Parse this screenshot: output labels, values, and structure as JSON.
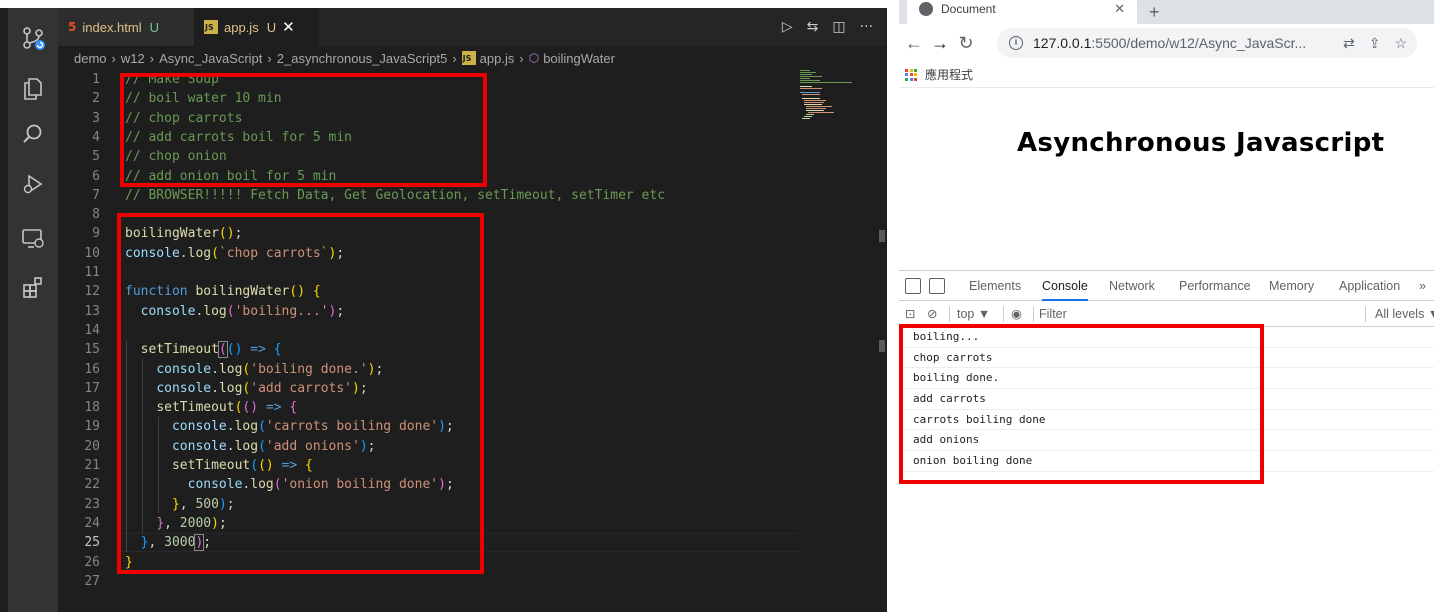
{
  "vscode": {
    "tabs": [
      {
        "label": "index.html",
        "status": "U",
        "icon": "html-file-icon"
      },
      {
        "label": "app.js",
        "status": "U",
        "icon": "js-file-icon",
        "active": true
      }
    ],
    "js_icon_text": "JS",
    "breadcrumb": [
      "demo",
      "w12",
      "Async_JavaScript",
      "2_asynchronous_JavaScript5",
      "app.js",
      "boilingWater"
    ],
    "current_line": 25
  },
  "browser": {
    "tab_title": "Document",
    "address": {
      "host": "127.0.0.1",
      "rest": ":5500/demo/w12/Async_JavaScr..."
    },
    "bookmarks_label": "應用程式",
    "page_heading": "Asynchronous Javascript",
    "devtools": {
      "tabs": [
        "Elements",
        "Console",
        "Network",
        "Performance",
        "Memory",
        "Application"
      ],
      "active_tab": "Console",
      "more": "»",
      "context": "top ▼",
      "filter_placeholder": "Filter",
      "levels": "All levels ▼"
    },
    "console_output": [
      "boiling...",
      "chop carrots",
      "boiling done.",
      "add carrots",
      "carrots boiling done",
      "add onions",
      "onion boiling done"
    ]
  },
  "colors": {
    "editor_bg": "#1e1e1e",
    "annotation_red": "#ee0000",
    "devtools_active_blue": "#1a73e8"
  }
}
